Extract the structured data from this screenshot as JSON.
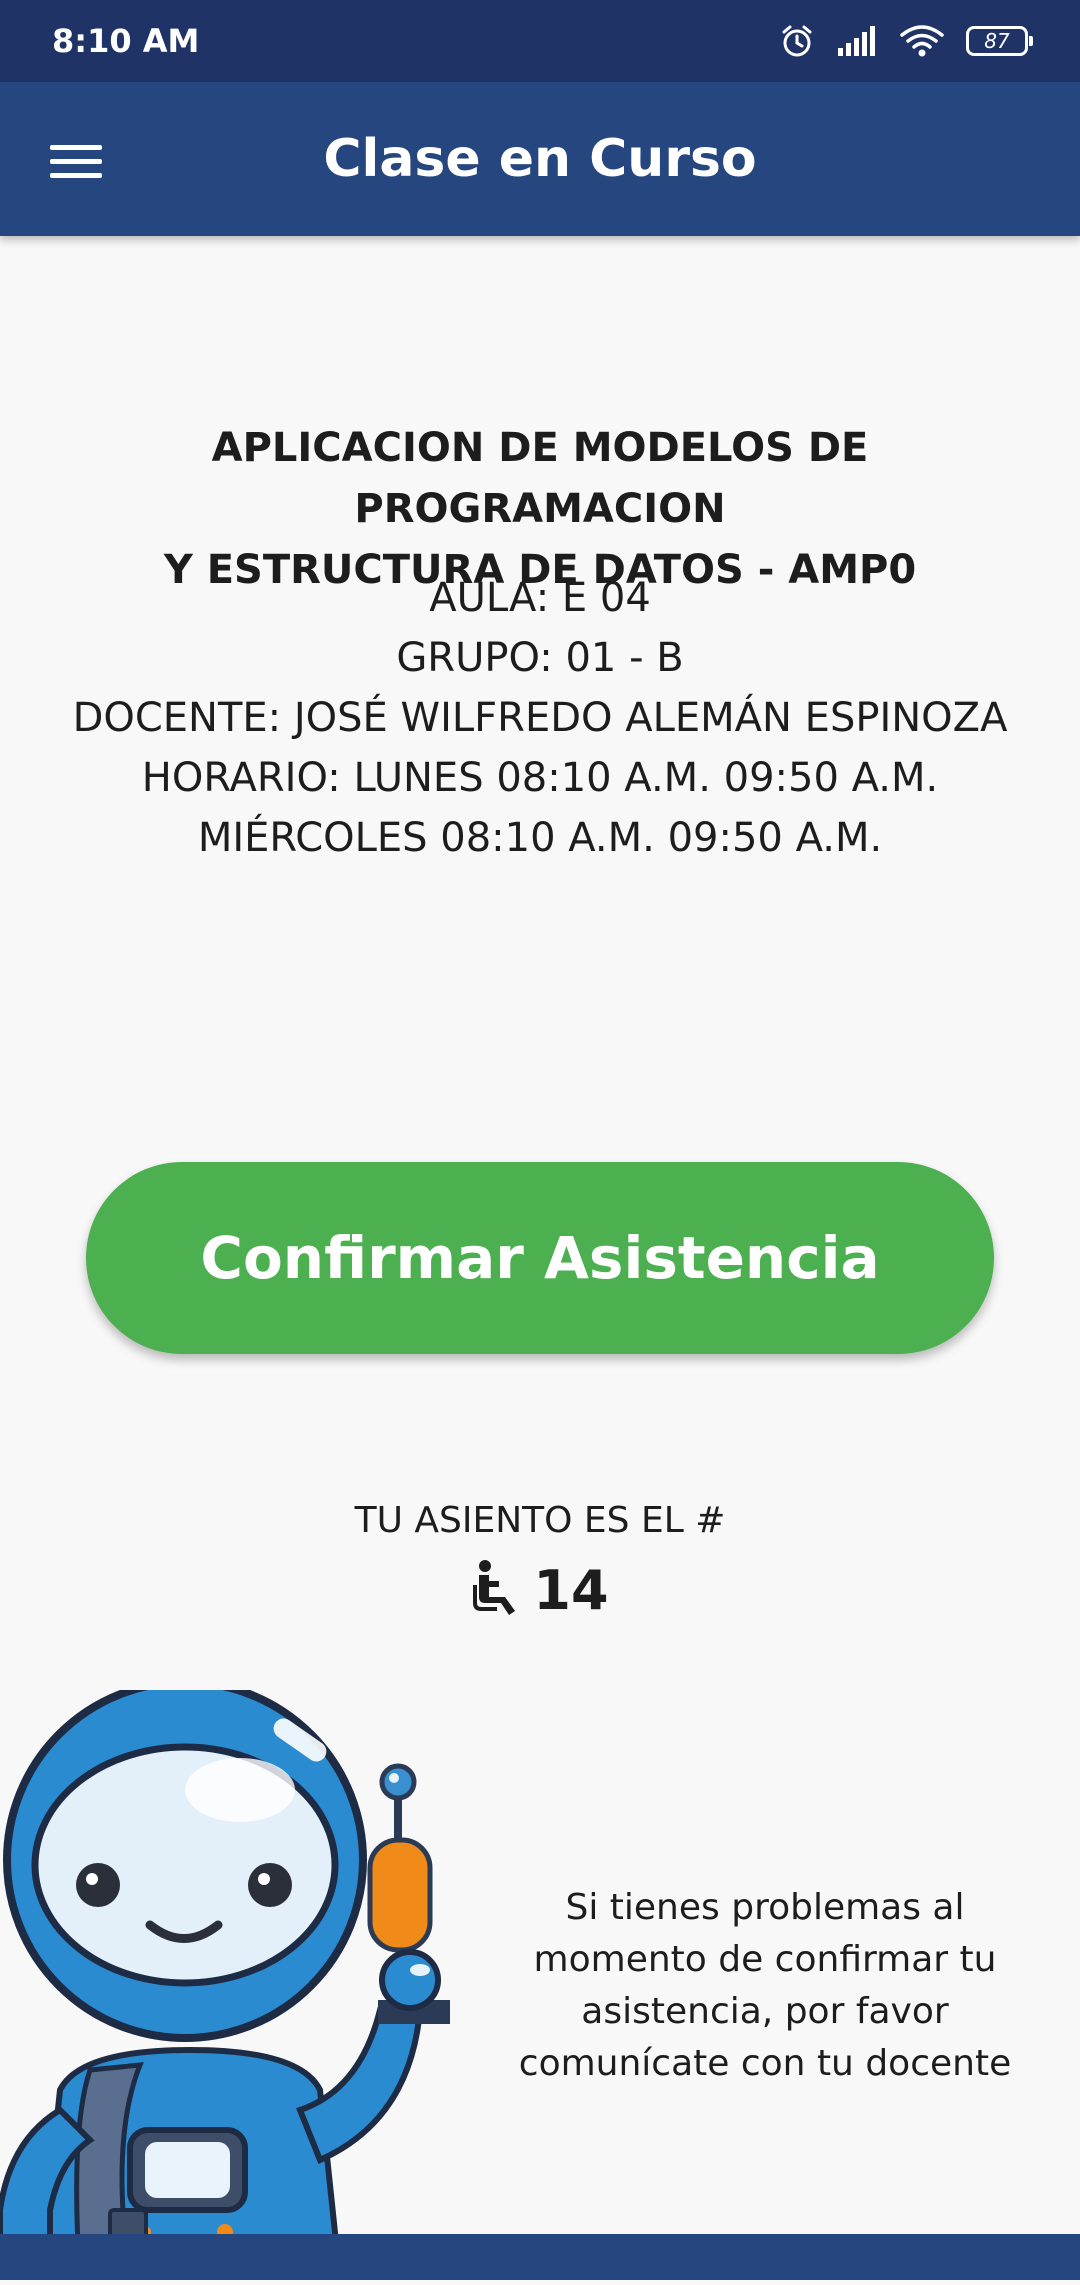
{
  "status_bar": {
    "time": "8:10 AM",
    "battery": "87",
    "icons": [
      "alarm-icon",
      "signal-icon",
      "wifi-icon",
      "battery-icon"
    ]
  },
  "app_bar": {
    "title": "Clase en Curso",
    "menu_icon": "hamburger-menu-icon"
  },
  "course": {
    "title_line1": "APLICACION DE MODELOS DE PROGRAMACION",
    "title_line2": "Y ESTRUCTURA DE DATOS -  AMP0",
    "aula": "AULA: E 04",
    "grupo": "GRUPO: 01 -  B",
    "docente": "DOCENTE: JOSÉ WILFREDO ALEMÁN ESPINOZA",
    "horario_1": "HORARIO: LUNES 08:10 A.M. 09:50 A.M.",
    "horario_2": "MIÉRCOLES 08:10 A.M. 09:50 A.M."
  },
  "confirm_button": {
    "label": "Confirmar Asistencia"
  },
  "seat": {
    "label": "TU ASIENTO ES EL #",
    "number": "14",
    "icon": "seat-icon"
  },
  "help": {
    "line1": "Si tienes problemas al",
    "line2": "momento de confirmar tu",
    "line3": "asistencia, por favor",
    "line4": "comunícate con tu docente"
  },
  "colors": {
    "status_bar": "#1f3366",
    "app_bar": "#26467f",
    "confirm_button": "#4caf50",
    "background": "#f8f8f8"
  }
}
